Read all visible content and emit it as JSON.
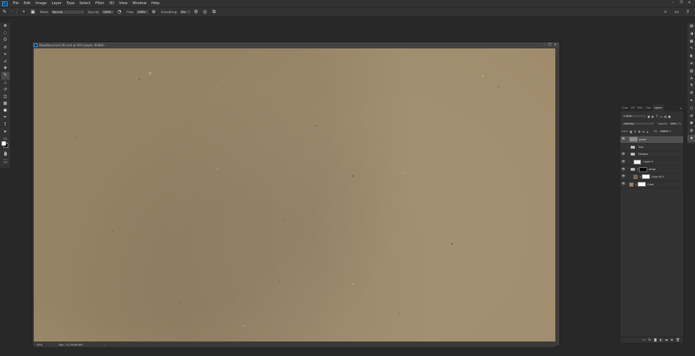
{
  "menu": {
    "logo": "Ps",
    "items": [
      "File",
      "Edit",
      "Image",
      "Layer",
      "Type",
      "Select",
      "Filter",
      "3D",
      "View",
      "Window",
      "Help"
    ],
    "window_controls": [
      "–",
      "❐",
      "✕"
    ]
  },
  "options": {
    "mode_label": "Mode:",
    "mode_value": "Normal",
    "opacity_label": "Opacity:",
    "opacity_value": "100%",
    "flow_label": "Flow:",
    "flow_value": "100%",
    "smoothing_label": "Smoothing:",
    "smoothing_value": "0%"
  },
  "tools": [
    "move-tool",
    "marquee-tool",
    "lasso-tool",
    "quick-select-tool",
    "crop-tool",
    "eyedropper-tool",
    "healing-tool",
    "brush-tool",
    "clone-stamp-tool",
    "history-brush-tool",
    "eraser-tool",
    "gradient-tool",
    "dodge-tool",
    "pen-tool",
    "type-tool",
    "path-select-tool",
    "rectangle-tool",
    "hand-tool",
    "zoom-tool",
    "more-tools"
  ],
  "tool_glyphs": [
    "✥",
    "◌",
    "ʘ",
    "⊘",
    "⌗",
    "⊿",
    "✚",
    "✎",
    "⊥",
    "↺",
    "◫",
    "▦",
    "●",
    "✒",
    "T",
    "➤",
    "▭",
    "✋",
    "⌕",
    "···"
  ],
  "document": {
    "title": "BlowDocument_W1.psd @ 50% (paper, RGB/8)",
    "zoom": "50%",
    "info": "Doc: 15.7M/96.6M",
    "arrow": "›"
  },
  "panel": {
    "tabs": [
      "Chan",
      "3D",
      "Path",
      "Char",
      "Layers"
    ],
    "selected_tab": "Layers",
    "filter_label": "Kind",
    "blend_mode": "Overlay",
    "opacity_label": "Opacity:",
    "opacity_value": "30%",
    "lock_label": "Lock:",
    "fill_label": "Fill:",
    "fill_value": "100%",
    "layers": [
      {
        "name": "paper",
        "type": "layer",
        "visible": true,
        "selected": true,
        "thumb": "#8c8c8c"
      },
      {
        "name": "Text",
        "type": "group",
        "visible": false,
        "selected": false
      },
      {
        "name": "Designs",
        "type": "group",
        "visible": true,
        "selected": false
      },
      {
        "name": "Layer 2",
        "type": "layer",
        "visible": true,
        "selected": false,
        "thumb": "#f2f2f2",
        "indent": true
      },
      {
        "name": "stripe",
        "type": "group-mask",
        "visible": true,
        "selected": false,
        "thumb": "#000000"
      },
      {
        "name": "Color Fill 1",
        "type": "fill",
        "visible": true,
        "selected": false,
        "thumb": "#7a6149",
        "mask": "#ffffff",
        "indent": true
      },
      {
        "name": "Color",
        "type": "fill",
        "visible": true,
        "selected": false,
        "thumb": "#a2835c",
        "mask": "#ffffff"
      }
    ]
  },
  "colors": {
    "canvas": "#9f8b6c",
    "accent": "#31a8ff"
  }
}
